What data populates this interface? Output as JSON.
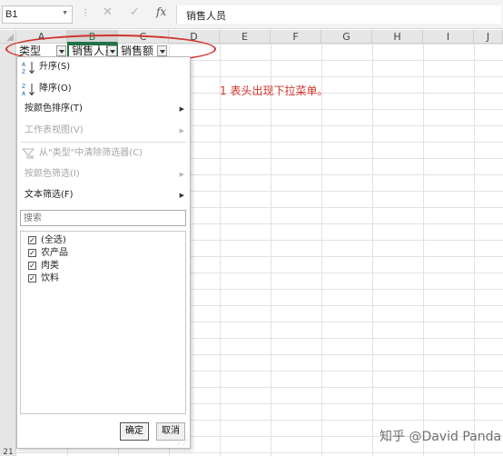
{
  "formula_bar": {
    "name_box": "B1",
    "cancel_glyph": "✕",
    "enter_glyph": "✓",
    "fx_label": "fx",
    "formula_value": "销售人员"
  },
  "columns": [
    "A",
    "B",
    "C",
    "D",
    "E",
    "F",
    "G",
    "H",
    "I",
    "J"
  ],
  "selected_column": "B",
  "row_numbers": [
    "21"
  ],
  "header_cells": {
    "a1": "类型",
    "b1": "销售人员",
    "c1": "销售额"
  },
  "annotation": "1 表头出现下拉菜单。",
  "filter_menu": {
    "sort_ascending": "升序(S)",
    "sort_descending": "降序(O)",
    "sort_by_color": "按颜色排序(T)",
    "sheet_view": "工作表视图(V)",
    "clear_filter": "从\"类型\"中清除筛选器(C)",
    "filter_by_color": "按颜色筛选(I)",
    "text_filters": "文本筛选(F)",
    "search_placeholder": "搜索",
    "items": [
      {
        "label": "(全选)",
        "checked": true
      },
      {
        "label": "农产品",
        "checked": true
      },
      {
        "label": "肉类",
        "checked": true
      },
      {
        "label": "饮料",
        "checked": true
      }
    ],
    "ok_label": "确定",
    "cancel_label": "取消"
  },
  "watermark": "知乎 @David Panda",
  "colors": {
    "accent_green": "#217346",
    "annotation_red": "#d0342c"
  }
}
